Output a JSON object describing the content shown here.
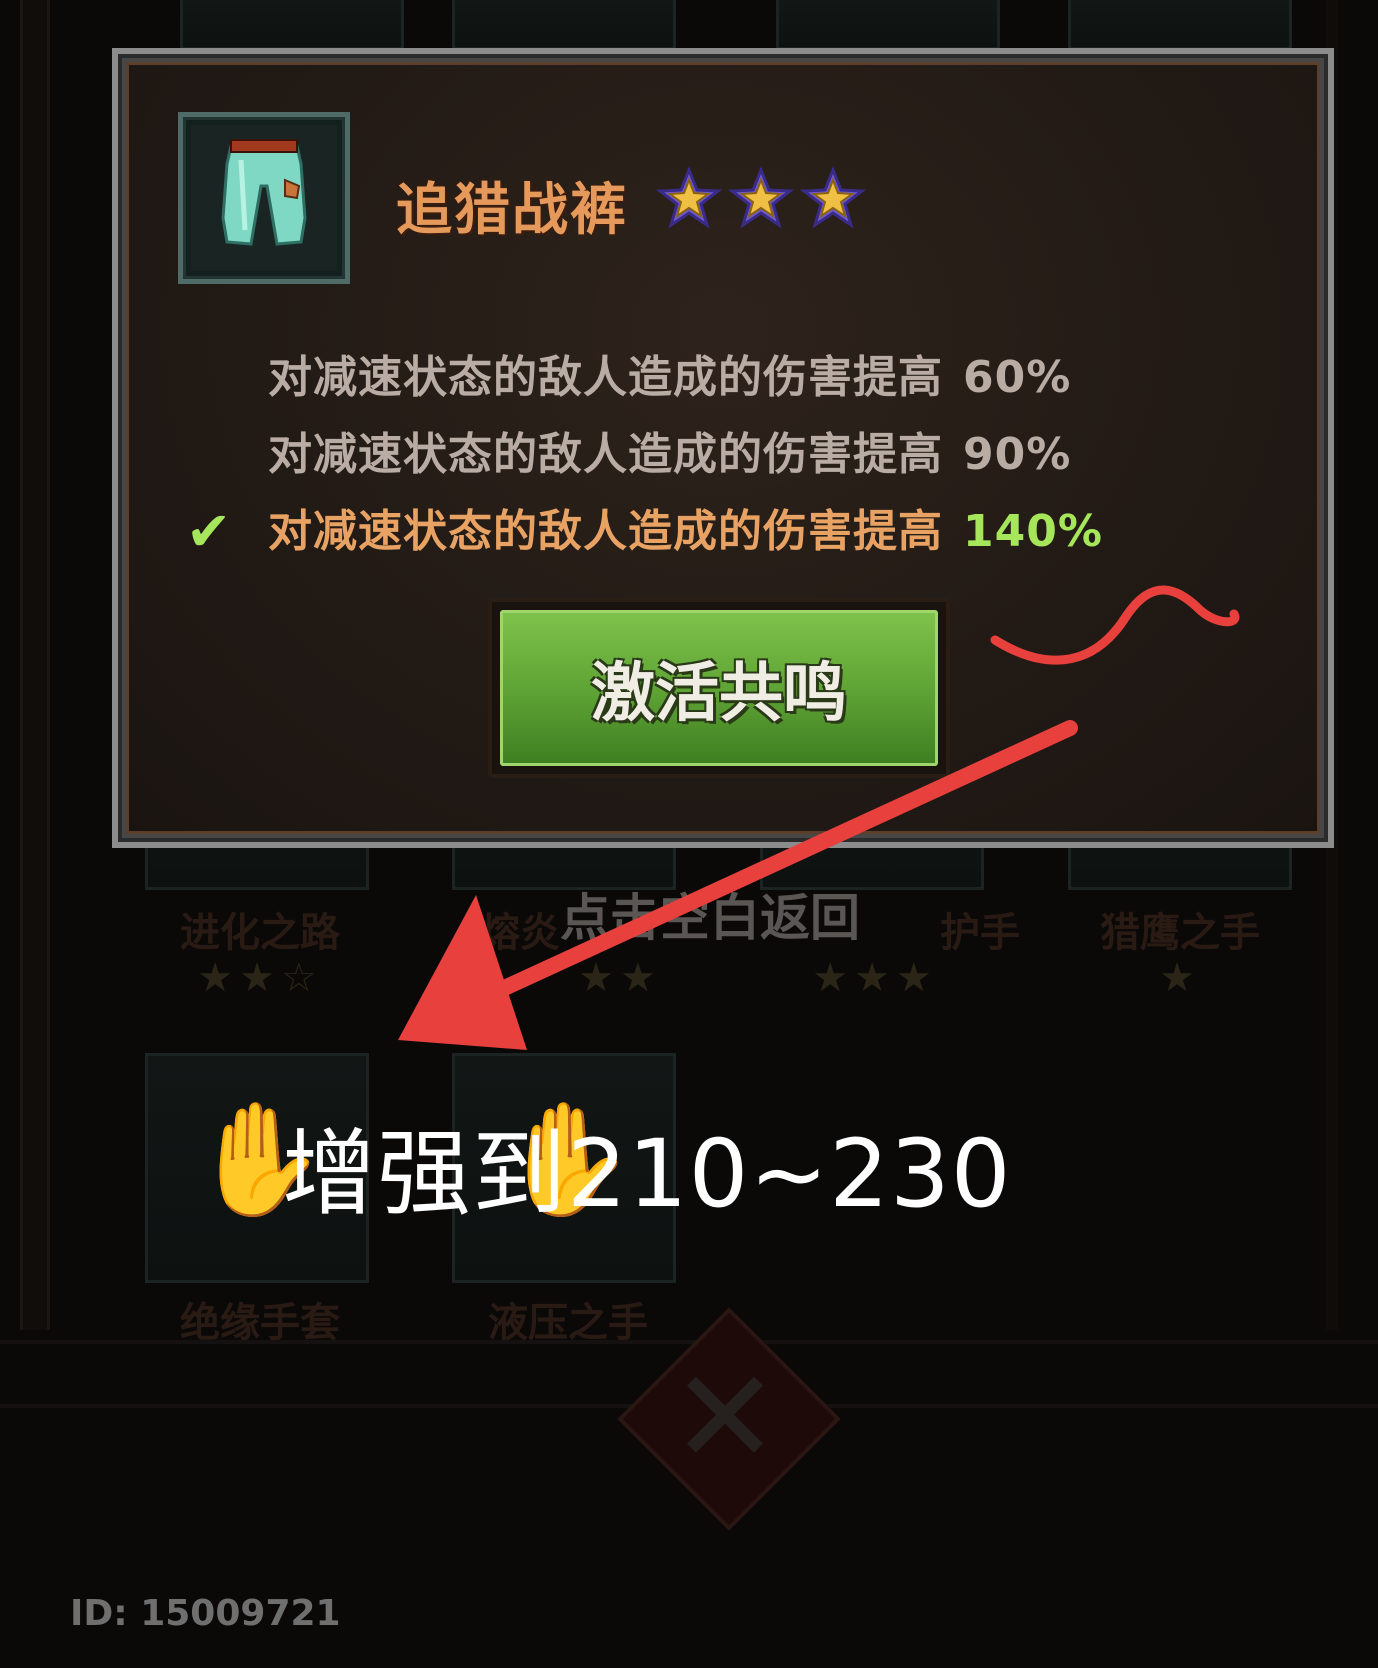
{
  "popup": {
    "item_name": "追猎战裤",
    "star_count": 3,
    "item_icon": "pants-icon",
    "bonus_lines": [
      {
        "text": "对减速状态的敌人造成的伤害提高",
        "value": "60%",
        "active": false
      },
      {
        "text": "对减速状态的敌人造成的伤害提高",
        "value": "90%",
        "active": false
      },
      {
        "text": "对减速状态的敌人造成的伤害提高",
        "value": "140%",
        "active": true
      }
    ],
    "activate_button_label": "激活共鸣"
  },
  "background": {
    "return_hint": "点击空白返回",
    "items": [
      {
        "label": "进化之路",
        "stars": "★★☆"
      },
      {
        "label": "熔炎",
        "stars": "★★"
      },
      {
        "label": "护手",
        "stars": "★★★"
      },
      {
        "label": "猎鹰之手",
        "stars": "★"
      },
      {
        "label": "绝缘手套"
      },
      {
        "label": "液压之手"
      }
    ]
  },
  "annotation": {
    "text": "增强到210~230",
    "color": "#e8403c"
  },
  "footer": {
    "id_label": "ID: 15009721"
  },
  "colors": {
    "title_orange": "#e59a5c",
    "active_green": "#a6e65a",
    "button_green": "#5fa535",
    "inactive_text": "#b8aca4"
  }
}
